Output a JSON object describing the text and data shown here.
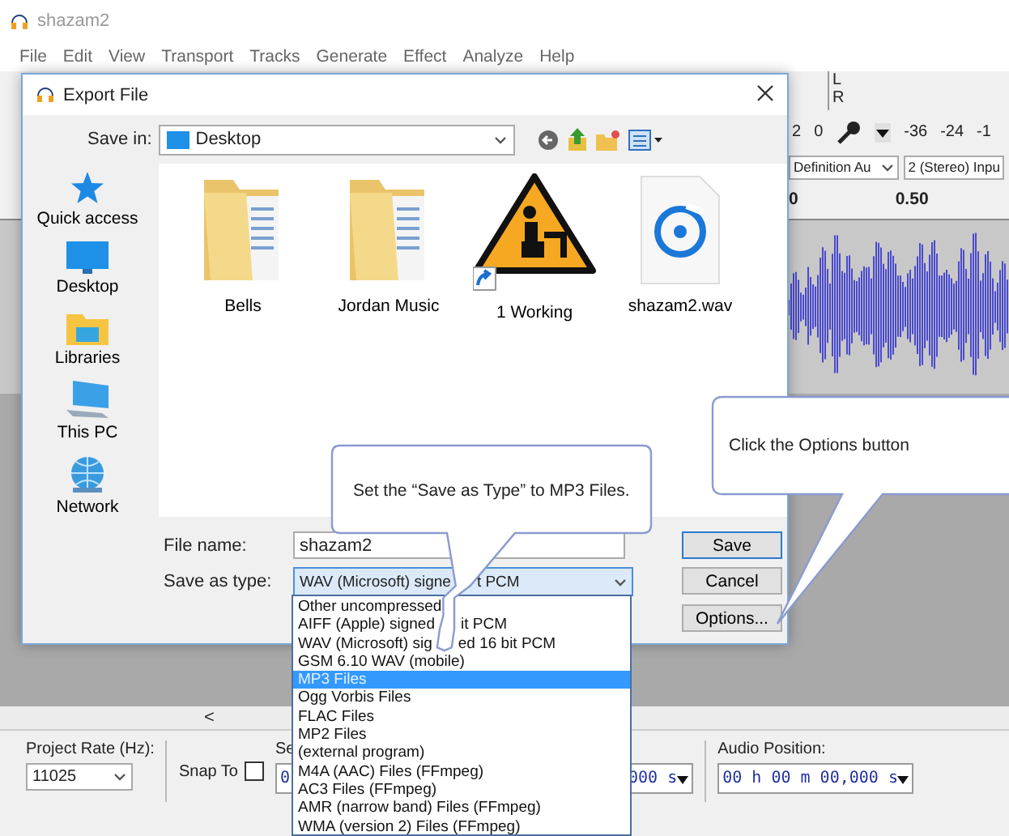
{
  "app": {
    "title": "shazam2",
    "menu": [
      "File",
      "Edit",
      "View",
      "Transport",
      "Tracks",
      "Generate",
      "Effect",
      "Analyze",
      "Help"
    ],
    "meter": {
      "channels": [
        "L",
        "R"
      ],
      "ticks": [
        "2",
        "0",
        "-36",
        "-24",
        "-1"
      ]
    },
    "device_bar": {
      "host": "Definition Au",
      "channels": "2 (Stereo) Inpu"
    },
    "ruler": [
      "0",
      "0.50"
    ],
    "scroll_arrow": "<",
    "selection_bar": {
      "rate_label": "Project Rate (Hz):",
      "rate": "11025",
      "snap_label": "Snap To",
      "snap_checked": false,
      "selection_label": "Se",
      "selection_start": "0",
      "selection_end": "000 s",
      "position_label": "Audio Position:",
      "position": "00 h 00 m 00,000 s"
    }
  },
  "dialog": {
    "title": "Export File",
    "save_in_label": "Save in:",
    "save_in": "Desktop",
    "places": [
      {
        "kind": "star",
        "label": "Quick access"
      },
      {
        "kind": "desktop",
        "label": "Desktop"
      },
      {
        "kind": "libraries",
        "label": "Libraries"
      },
      {
        "kind": "pc",
        "label": "This PC"
      },
      {
        "kind": "network",
        "label": "Network"
      }
    ],
    "files": [
      {
        "kind": "folder",
        "name": "Bells"
      },
      {
        "kind": "folder",
        "name": "Jordan Music"
      },
      {
        "kind": "shortcut",
        "name": "1 Working"
      },
      {
        "kind": "audio",
        "name": "shazam2.wav"
      }
    ],
    "file_name_label": "File name:",
    "file_name": "shazam2",
    "type_label": "Save as type:",
    "type_value": [
      "WAV (Microsoft) signe",
      "t PCM"
    ],
    "buttons": [
      "Save",
      "Cancel",
      "Options..."
    ],
    "type_options": [
      {
        "label": [
          "Other uncompressed"
        ],
        "selected": false
      },
      {
        "label": [
          "AIFF (Apple) signed",
          "it PCM"
        ],
        "selected": false
      },
      {
        "label": [
          "WAV (Microsoft) sig",
          "ed 16 bit PCM"
        ],
        "selected": false
      },
      {
        "label": [
          "GSM 6.10 WAV (mobile)"
        ],
        "selected": false
      },
      {
        "label": [
          "MP3 Files"
        ],
        "selected": true
      },
      {
        "label": [
          "Ogg Vorbis Files"
        ],
        "selected": false
      },
      {
        "label": [
          "FLAC Files"
        ],
        "selected": false
      },
      {
        "label": [
          "MP2 Files"
        ],
        "selected": false
      },
      {
        "label": [
          "(external program)"
        ],
        "selected": false
      },
      {
        "label": [
          "M4A (AAC) Files (FFmpeg)"
        ],
        "selected": false
      },
      {
        "label": [
          "AC3 Files (FFmpeg)"
        ],
        "selected": false
      },
      {
        "label": [
          "AMR (narrow band) Files (FFmpeg)"
        ],
        "selected": false
      },
      {
        "label": [
          "WMA (version 2) Files (FFmpeg)"
        ],
        "selected": false
      }
    ]
  },
  "callouts": [
    {
      "text": "Set the “Save as Type” to MP3 Files."
    },
    {
      "text": "Click the Options button"
    }
  ]
}
